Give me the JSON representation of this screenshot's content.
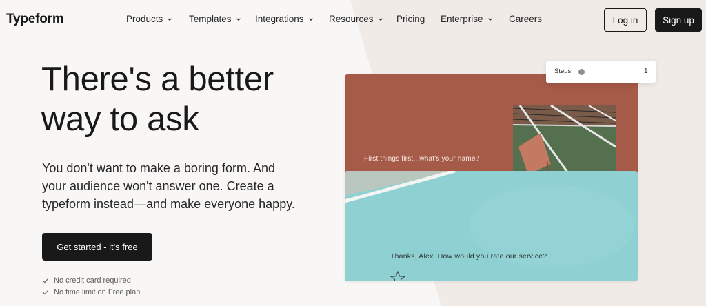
{
  "brand": {
    "logo": "Typeform"
  },
  "nav": {
    "items": [
      {
        "label": "Products",
        "has_dropdown": true
      },
      {
        "label": "Templates",
        "has_dropdown": true
      },
      {
        "label": "Integrations",
        "has_dropdown": true
      },
      {
        "label": "Resources",
        "has_dropdown": true
      },
      {
        "label": "Pricing",
        "has_dropdown": false
      },
      {
        "label": "Enterprise",
        "has_dropdown": true
      },
      {
        "label": "Careers",
        "has_dropdown": false
      }
    ],
    "login_label": "Log in",
    "signup_label": "Sign up"
  },
  "hero": {
    "title_line1": "There's a better",
    "title_line2": "way to ask",
    "subtitle_line1": "You don't want to make a boring form. And",
    "subtitle_line2": "your audience won't answer one. Create a",
    "subtitle_line3": "typeform instead—and make everyone happy.",
    "cta_label": "Get started - it's free",
    "checks": [
      "No credit card required",
      "No time limit on Free plan"
    ]
  },
  "demo": {
    "question1": "First things first...what's your name?",
    "question2": "Thanks, Alex. How would you rate our service?",
    "steps_label": "Steps",
    "steps_value": "1",
    "top_color": "#a65a48",
    "bottom_color": "#8dcfd1"
  }
}
